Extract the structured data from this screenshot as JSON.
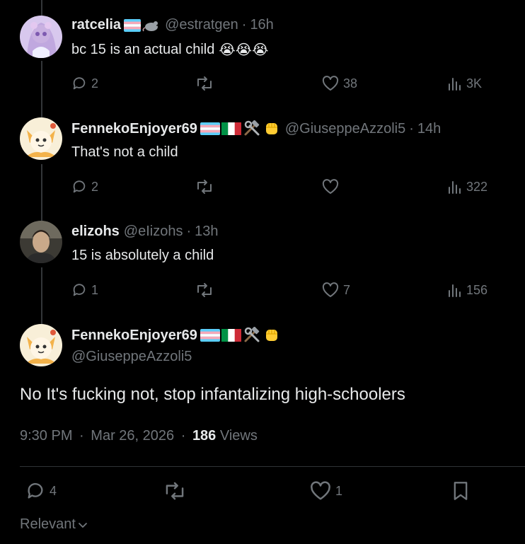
{
  "posts": [
    {
      "name": "ratcelia",
      "handle": "@estratgen",
      "separator": "·",
      "time": "16h",
      "text": "bc 15 is an actual child",
      "emoji": [
        "😭",
        "😭",
        "😭"
      ],
      "actions": {
        "replies": "2",
        "reposts": "",
        "likes": "38",
        "views": "3K"
      }
    },
    {
      "name": "FennekoEnjoyer69",
      "handle": "@GiuseppeAzzoli5",
      "separator": "·",
      "time": "14h",
      "text": "That's not a child",
      "actions": {
        "replies": "2",
        "reposts": "",
        "likes": "",
        "views": "322"
      }
    },
    {
      "name": "elizohs",
      "handle": "@eIizohs",
      "separator": "·",
      "time": "13h",
      "text": "15 is absolutely a child",
      "actions": {
        "replies": "1",
        "reposts": "",
        "likes": "7",
        "views": "156"
      }
    }
  ],
  "main_post": {
    "name": "FennekoEnjoyer69",
    "handle": "@GiuseppeAzzoli5",
    "text": "No It's fucking not, stop infantalizing high-schoolers",
    "time": "9:30 PM",
    "separator": "·",
    "date": "Mar 26, 2026",
    "views_count": "186",
    "views_label": "Views",
    "actions": {
      "replies": "4",
      "reposts": "",
      "likes": "1"
    }
  },
  "sort": {
    "label": "Relevant"
  },
  "colors": {
    "background": "#000000",
    "text": "#e7e9ea",
    "muted": "#71767b",
    "thread_line": "#333639",
    "divider": "#2f3336"
  },
  "icons": [
    "reply-icon",
    "repost-icon",
    "like-icon",
    "views-icon",
    "bookmark-icon",
    "chevron-down-icon",
    "trans-flag-icon",
    "rat-icon",
    "italy-flag-icon",
    "hammer-wrench-icon",
    "fist-icon"
  ]
}
